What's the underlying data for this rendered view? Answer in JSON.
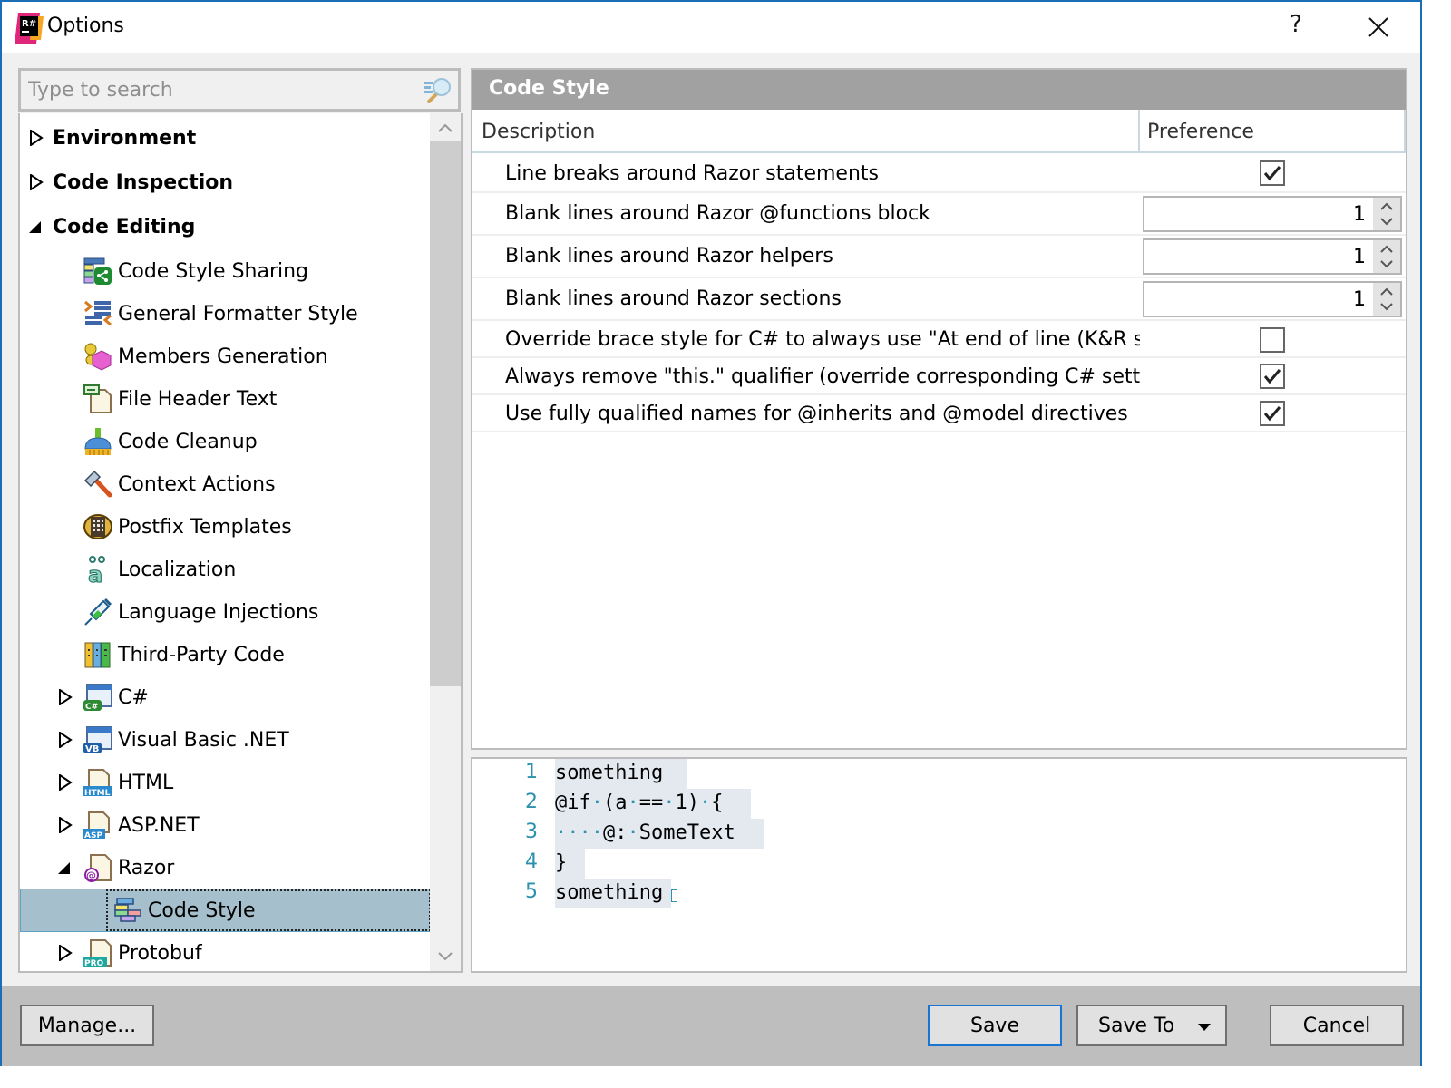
{
  "window": {
    "title": "Options",
    "app_icon": "resharper-logo-icon",
    "help_label": "?",
    "close_icon": "close-icon",
    "accent_color": "#1a6eb5"
  },
  "search": {
    "placeholder": "Type to search",
    "value": "",
    "icon": "search-icon"
  },
  "tree": {
    "items": [
      {
        "label": "Environment",
        "level": 0,
        "state": "collapsed",
        "bold": true
      },
      {
        "label": "Code Inspection",
        "level": 0,
        "state": "collapsed",
        "bold": true
      },
      {
        "label": "Code Editing",
        "level": 0,
        "state": "expanded",
        "bold": true
      },
      {
        "label": "Code Style Sharing",
        "level": 1,
        "icon": "code-style-sharing-icon"
      },
      {
        "label": "General Formatter Style",
        "level": 1,
        "icon": "formatter-icon"
      },
      {
        "label": "Members Generation",
        "level": 1,
        "icon": "members-generation-icon"
      },
      {
        "label": "File Header Text",
        "level": 1,
        "icon": "file-header-icon"
      },
      {
        "label": "Code Cleanup",
        "level": 1,
        "icon": "broom-icon"
      },
      {
        "label": "Context Actions",
        "level": 1,
        "icon": "hammer-icon"
      },
      {
        "label": "Postfix Templates",
        "level": 1,
        "icon": "postfix-templates-icon"
      },
      {
        "label": "Localization",
        "level": 1,
        "icon": "localization-icon"
      },
      {
        "label": "Language Injections",
        "level": 1,
        "icon": "syringe-icon"
      },
      {
        "label": "Third-Party Code",
        "level": 1,
        "icon": "books-icon"
      },
      {
        "label": "C#",
        "level": 1,
        "state": "collapsed",
        "icon": "csharp-icon",
        "badge": "C#"
      },
      {
        "label": "Visual Basic .NET",
        "level": 1,
        "state": "collapsed",
        "icon": "vb-icon",
        "badge": "VB"
      },
      {
        "label": "HTML",
        "level": 1,
        "state": "collapsed",
        "icon": "html-icon",
        "badge": "HTML"
      },
      {
        "label": "ASP.NET",
        "level": 1,
        "state": "collapsed",
        "icon": "asp-icon",
        "badge": "ASP"
      },
      {
        "label": "Razor",
        "level": 1,
        "state": "expanded",
        "icon": "razor-icon",
        "badge": "@"
      },
      {
        "label": "Code Style",
        "level": 2,
        "icon": "code-style-icon",
        "selected": true
      },
      {
        "label": "Protobuf",
        "level": 1,
        "state": "collapsed",
        "icon": "protobuf-icon",
        "badge": "PRO"
      }
    ],
    "selected_color": "#a5c0cc",
    "scroll_position": 0.0
  },
  "panel": {
    "title": "Code Style",
    "columns": {
      "description": "Description",
      "preference": "Preference"
    },
    "rows": [
      {
        "description": "Line breaks around Razor statements",
        "type": "checkbox",
        "checked": true
      },
      {
        "description": "Blank lines around Razor @functions block",
        "type": "number",
        "value": "1"
      },
      {
        "description": "Blank lines around Razor helpers",
        "type": "number",
        "value": "1"
      },
      {
        "description": "Blank lines around Razor sections",
        "type": "number",
        "value": "1"
      },
      {
        "description": "Override brace style for C# to always use \"At end of line (K&R sty...",
        "type": "checkbox",
        "checked": false
      },
      {
        "description": "Always remove \"this.\" qualifier (override corresponding C# setting)",
        "type": "checkbox",
        "checked": true
      },
      {
        "description": "Use fully qualified names for @inherits and @model directives",
        "type": "checkbox",
        "checked": true
      }
    ]
  },
  "preview": {
    "lines": [
      {
        "number": "1",
        "text": "something"
      },
      {
        "number": "2",
        "text": "@if·(a·==·1)·{"
      },
      {
        "number": "3",
        "text": "····@:·SomeText"
      },
      {
        "number": "4",
        "text": "}"
      },
      {
        "number": "5",
        "text": "something"
      }
    ],
    "line_number_color": "#2b91af",
    "highlight_color": "#e4e9f0"
  },
  "footer": {
    "manage_label": "Manage...",
    "save_label": "Save",
    "save_to_label": "Save To",
    "cancel_label": "Cancel"
  }
}
